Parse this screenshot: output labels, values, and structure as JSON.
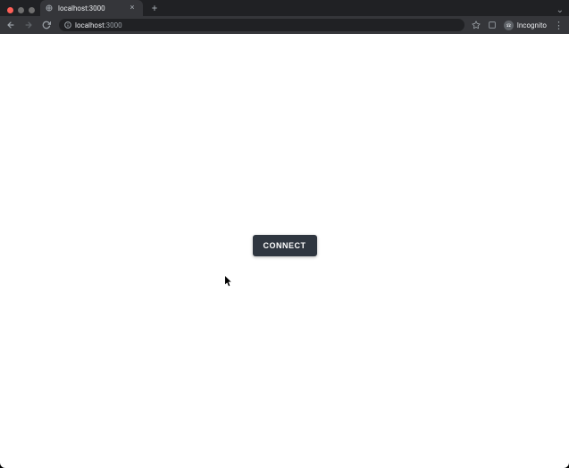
{
  "tab": {
    "title": "localhost:3000"
  },
  "address": {
    "host": "localhost",
    "port": ":3000"
  },
  "profile": {
    "label": "Incognito"
  },
  "page": {
    "connect_label": "CONNECT"
  }
}
